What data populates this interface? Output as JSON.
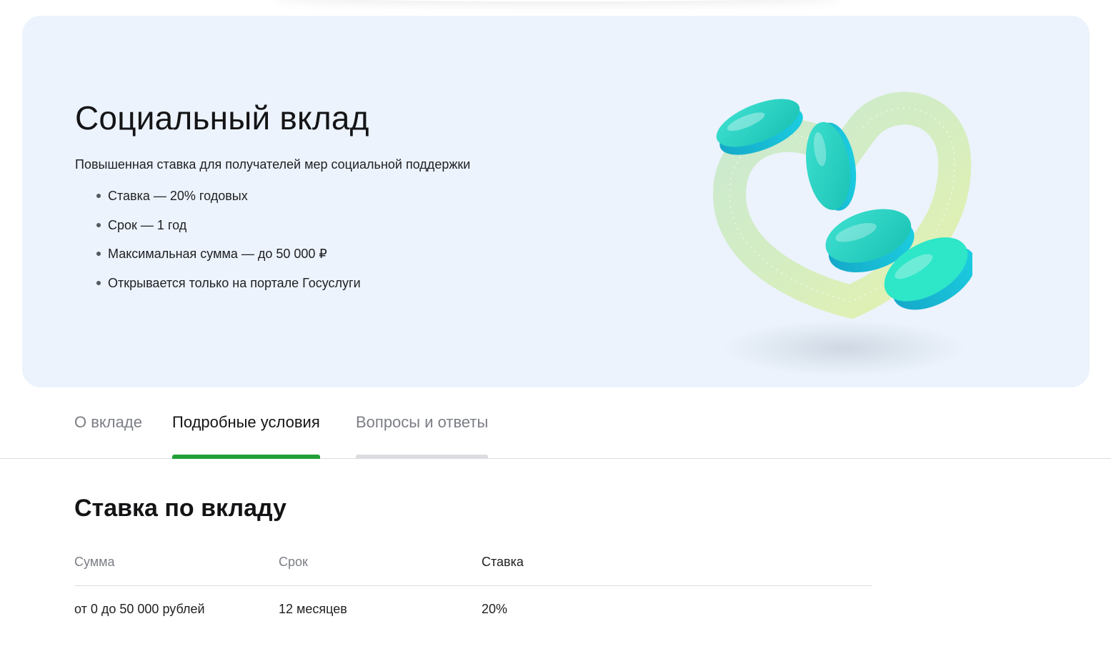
{
  "hero": {
    "title": "Социальный вклад",
    "subtitle": "Повышенная ставка для получателей мер социальной поддержки",
    "bullets": [
      "Ставка — 20% годовых",
      "Срок — 1 год",
      "Максимальная сумма — до 50 000 ₽",
      "Открывается только на портале Госуслуги"
    ],
    "background_color": "#ecf3fc"
  },
  "tabs": {
    "items": [
      {
        "label": "О вкладе"
      },
      {
        "label": "Подробные условия"
      },
      {
        "label": "Вопросы и ответы"
      }
    ],
    "active_index": 1,
    "active_color": "#21a038"
  },
  "rate_section": {
    "title": "Ставка по вкладу",
    "columns": [
      "Сумма",
      "Срок",
      "Ставка"
    ],
    "rows": [
      [
        "от 0 до 50 000 рублей",
        "12 месяцев",
        "20%"
      ]
    ]
  }
}
